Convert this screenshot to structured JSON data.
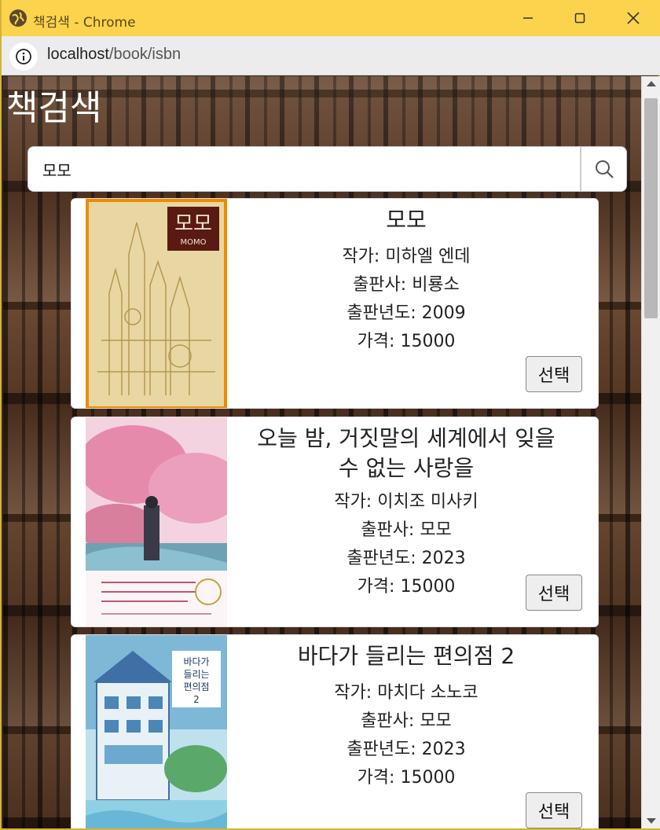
{
  "window": {
    "title": "책검색 - Chrome",
    "minimize_icon": "minimize-icon",
    "maximize_icon": "maximize-icon",
    "close_icon": "close-icon"
  },
  "address": {
    "host": "localhost",
    "path": "/book/isbn"
  },
  "page": {
    "heading": "책검색"
  },
  "search": {
    "value": "모모",
    "button_icon": "search-icon"
  },
  "books": [
    {
      "title": "모모",
      "author_label": "작가: 미하엘 엔데",
      "publisher_label": "출판사: 비룡소",
      "year_label": "출판년도: 2009",
      "price_label": "가격: 15000",
      "select_label": "선택",
      "cover_title": "모모",
      "cover_subtitle": "MOMO",
      "cover_color": "#e8d7a2"
    },
    {
      "title": "오늘 밤, 거짓말의 세계에서 잊을 수 없는 사랑을",
      "author_label": "작가: 이치조 미사키",
      "publisher_label": "출판사: 모모",
      "year_label": "출판년도: 2023",
      "price_label": "가격: 15000",
      "select_label": "선택",
      "cover_color": "#e7a8c0"
    },
    {
      "title": "바다가 들리는 편의점 2",
      "author_label": "작가: 마치다 소노코",
      "publisher_label": "출판사: 모모",
      "year_label": "출판년도: 2023",
      "price_label": "가격: 15000",
      "select_label": "선택",
      "cover_title": "바다가 들리는 편의점 2",
      "cover_color": "#7fb8d6"
    }
  ],
  "colors": {
    "titlebar": "#fcd34d",
    "card_bg": "#ffffff"
  }
}
